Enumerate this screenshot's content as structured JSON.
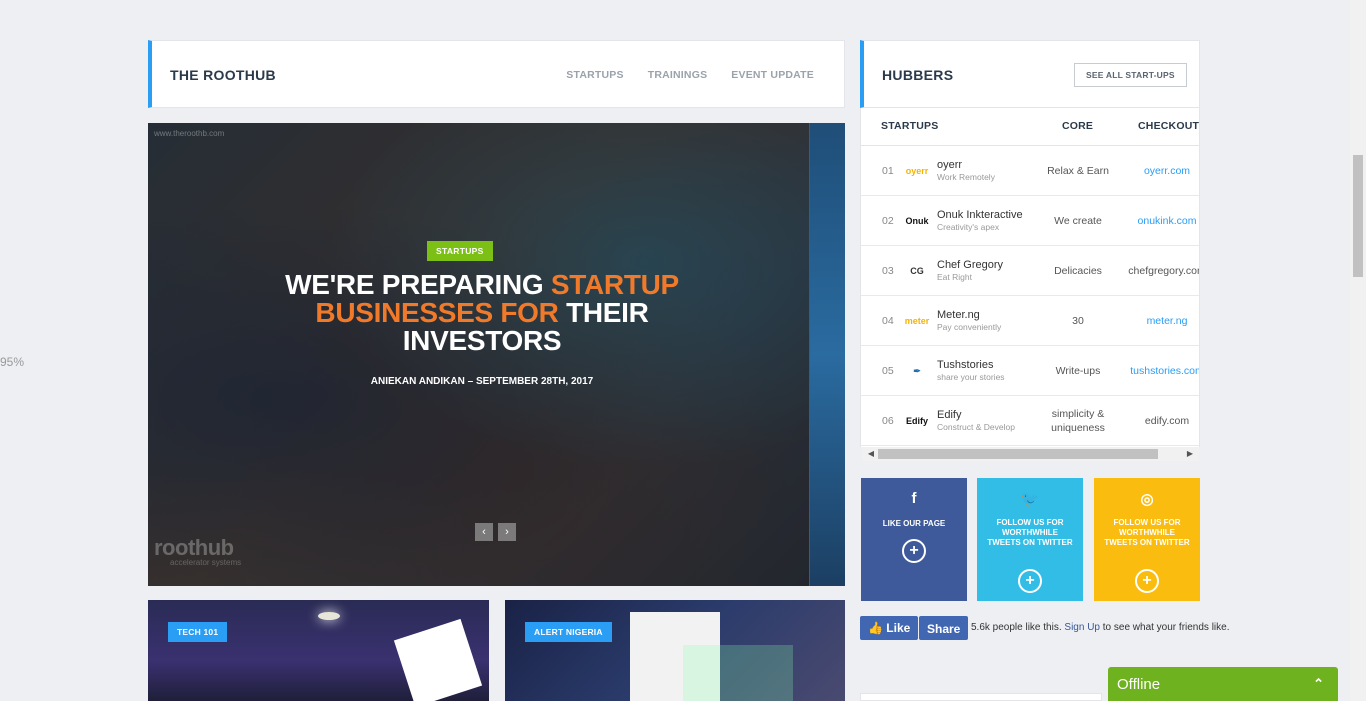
{
  "zoom": "95%",
  "main": {
    "title": "THE ROOTHUB",
    "nav": [
      "STARTUPS",
      "TRAININGS",
      "EVENT UPDATE"
    ]
  },
  "hero": {
    "watermark": "www.theroothb.com",
    "badge": "STARTUPS",
    "heading_part1": "WE'RE PREPARING ",
    "heading_accent1": "STARTUP",
    "heading_accent2": "BUSINESSES FOR",
    "heading_part2": " THEIR",
    "heading_part3": "INVESTORS",
    "byline": "ANIEKAN ANDIKAN – SEPTEMBER 28TH, 2017",
    "logo": "roothub",
    "logo_sub": "accelerator systems",
    "prev_arrow": "‹",
    "next_arrow": "›"
  },
  "cards": [
    {
      "badge": "TECH 101"
    },
    {
      "badge": "ALERT NIGERIA"
    }
  ],
  "sidebar": {
    "title": "HUBBERS",
    "see_all": "SEE ALL START-UPS",
    "columns": [
      "STARTUPS",
      "CORE",
      "CHECKOUT"
    ],
    "rows": [
      {
        "num": "01",
        "logo": "oyerr",
        "name": "oyerr",
        "tagline": "Work Remotely",
        "core": "Relax & Earn",
        "checkout": "oyerr.com",
        "link": true,
        "logo_color": "#f5b400"
      },
      {
        "num": "02",
        "logo": "Onuk",
        "name": "Onuk Inkteractive",
        "tagline": "Creativity's apex",
        "core": "We create",
        "checkout": "onukink.com",
        "link": true,
        "logo_color": "#111111"
      },
      {
        "num": "03",
        "logo": "CG",
        "name": "Chef Gregory",
        "tagline": "Eat Right",
        "core": "Delicacies",
        "checkout": "chefgregory.com",
        "link": false,
        "logo_color": "#333333"
      },
      {
        "num": "04",
        "logo": "meter",
        "name": "Meter.ng",
        "tagline": "Pay conveniently",
        "core": "30",
        "checkout": "meter.ng",
        "link": true,
        "logo_color": "#f5b400"
      },
      {
        "num": "05",
        "logo": "✒",
        "name": "Tushstories",
        "tagline": "share your stories",
        "core": "Write-ups",
        "checkout": "tushstories.com",
        "link": true,
        "logo_color": "#1e6fb0"
      },
      {
        "num": "06",
        "logo": "Edify",
        "name": "Edify",
        "tagline": "Construct & Develop",
        "core": "simplicity & uniqueness",
        "checkout": "edify.com",
        "link": false,
        "logo_color": "#111111"
      }
    ]
  },
  "social": [
    {
      "icon": "f",
      "icon_name": "facebook-icon",
      "text": "LIKE OUR PAGE"
    },
    {
      "icon": "🐦",
      "icon_name": "twitter-icon",
      "text": "FOLLOW US FOR WORTHWHILE TWEETS ON TWITTER"
    },
    {
      "icon": "◎",
      "icon_name": "instagram-icon",
      "text": "FOLLOW US FOR WORTHWHILE TWEETS ON TWITTER"
    }
  ],
  "plus": "+",
  "facebook": {
    "like": "👍 Like",
    "share": "Share",
    "count_text": "5.6k people like this.",
    "signup": "Sign Up",
    "rest": "to see what your friends like."
  },
  "chat": {
    "status": "Offline",
    "chevron": "⌃"
  }
}
